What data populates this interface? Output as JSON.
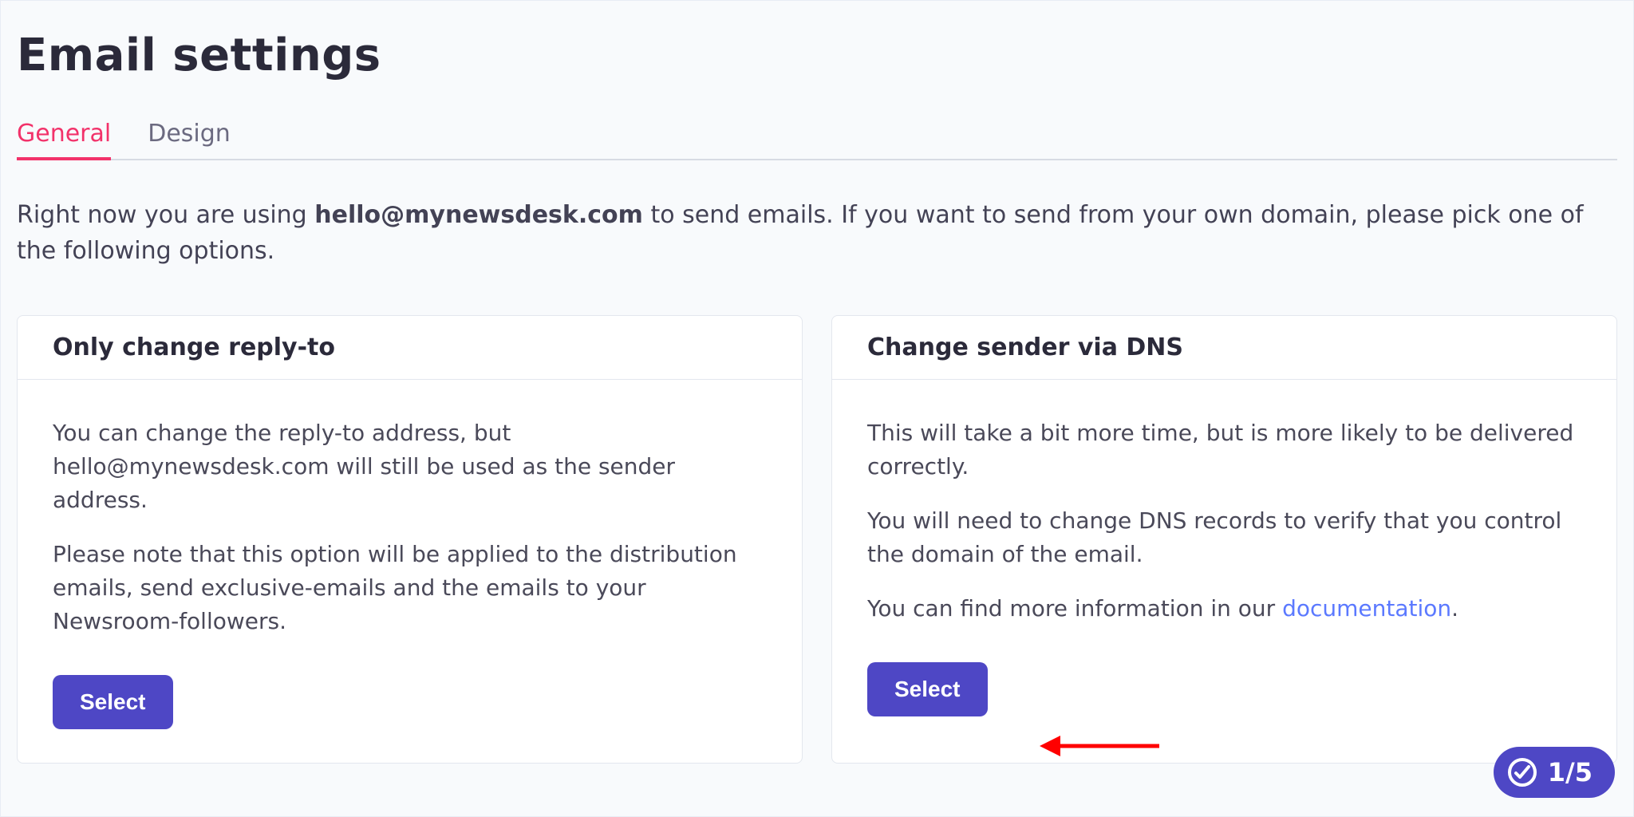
{
  "header": {
    "title": "Email settings"
  },
  "tabs": {
    "general": "General",
    "design": "Design"
  },
  "intro": {
    "prefix": "Right now you are using ",
    "email": "hello@mynewsdesk.com",
    "suffix": " to send emails. If you want to send from your own domain, please pick one of the following options."
  },
  "cards": {
    "reply_to": {
      "title": "Only change reply-to",
      "p1": "You can change the reply-to address, but hello@mynewsdesk.com will still be used as the sender address.",
      "p2": "Please note that this option will be applied to the distribution emails, send exclusive-emails and the emails to your Newsroom-followers.",
      "button": "Select"
    },
    "dns": {
      "title": "Change sender via DNS",
      "p1": "This will take a bit more time, but is more likely to be delivered correctly.",
      "p2": "You will need to change DNS records to verify that you control the domain of the email.",
      "p3_prefix": "You can find more information in our ",
      "p3_link": "documentation",
      "p3_suffix": ".",
      "button": "Select"
    }
  },
  "progress": {
    "label": "1/5"
  },
  "colors": {
    "accent_pink": "#f2326a",
    "purple": "#4e47c5",
    "link_blue": "#5b79ff"
  }
}
